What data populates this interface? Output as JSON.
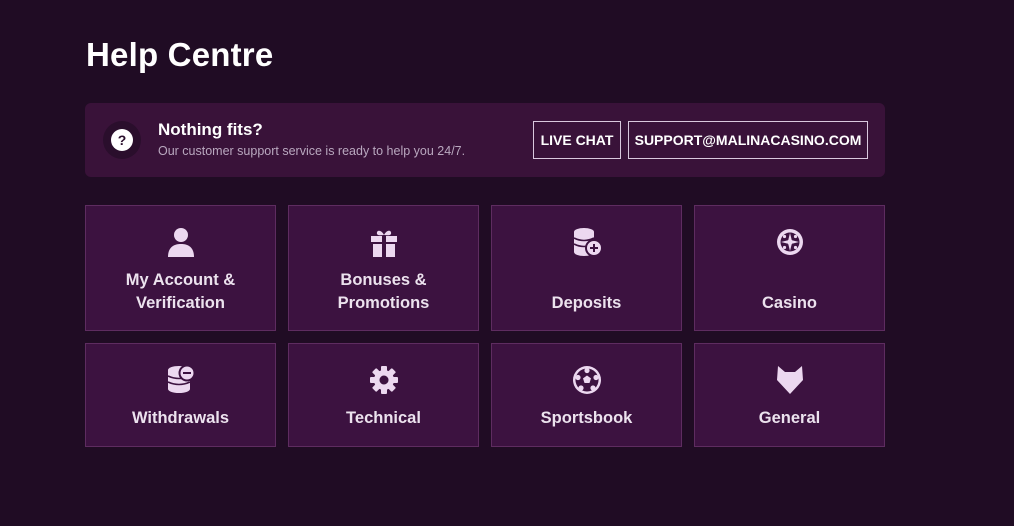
{
  "page": {
    "title": "Help Centre"
  },
  "support": {
    "icon": "question-icon",
    "icon_glyph": "?",
    "title": "Nothing fits?",
    "subtitle": "Our customer support service is ready to help you 24/7.",
    "live_chat_label": "LIVE CHAT",
    "email_label": "SUPPORT@MALINACASINO.COM"
  },
  "categories": [
    {
      "label": "My Account & Verification",
      "icon": "user-icon"
    },
    {
      "label": "Bonuses & Promotions",
      "icon": "gift-icon"
    },
    {
      "label": "Deposits",
      "icon": "coins-plus-icon"
    },
    {
      "label": "Casino",
      "icon": "roulette-icon"
    },
    {
      "label": "Withdrawals",
      "icon": "coins-minus-icon"
    },
    {
      "label": "Technical",
      "icon": "gear-icon"
    },
    {
      "label": "Sportsbook",
      "icon": "soccer-ball-icon"
    },
    {
      "label": "General",
      "icon": "fox-icon"
    }
  ],
  "colors": {
    "background": "#200c24",
    "banner": "#391239",
    "tile": "#3c1240",
    "tile_border": "#5e2c60",
    "icon": "#ecd8f0",
    "text": "#ffffff",
    "muted_text": "#b9a8bf"
  }
}
